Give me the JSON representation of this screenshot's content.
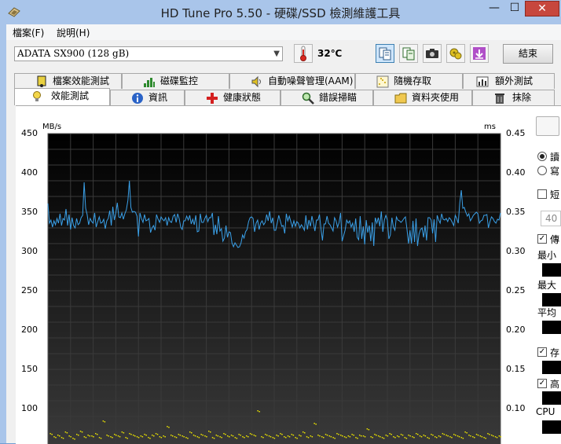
{
  "window": {
    "title": "HD Tune Pro 5.50 - 硬碟/SSD 檢測維護工具",
    "minimize_glyph": "—",
    "maximize_glyph": "☐",
    "close_glyph": "✕"
  },
  "menu": {
    "items": [
      "檔案(F)",
      "說明(H)"
    ]
  },
  "toolbar": {
    "drive": "ADATA SX900 (128 gB)",
    "temperature": "32℃",
    "exit_label": "結束",
    "buttons": [
      "copy-text-icon",
      "copy-info-icon",
      "screenshot-icon",
      "options-icon",
      "save-icon"
    ]
  },
  "tabs": {
    "row_back": [
      {
        "label": "檔案效能測試",
        "icon": "file-benchmark-icon"
      },
      {
        "label": "磁碟監控",
        "icon": "disk-monitor-icon"
      },
      {
        "label": "自動噪聲管理(AAM)",
        "icon": "speaker-icon"
      },
      {
        "label": "隨機存取",
        "icon": "random-access-icon"
      },
      {
        "label": "額外測試",
        "icon": "extra-tests-icon"
      }
    ],
    "row_front": [
      {
        "label": "效能測試",
        "icon": "benchmark-icon"
      },
      {
        "label": "資訊",
        "icon": "info-icon"
      },
      {
        "label": "健康狀態",
        "icon": "health-icon"
      },
      {
        "label": "錯誤掃瞄",
        "icon": "error-scan-icon"
      },
      {
        "label": "資料夾使用",
        "icon": "folder-icon"
      },
      {
        "label": "抹除",
        "icon": "erase-icon"
      }
    ],
    "selected": "效能測試"
  },
  "side_panel": {
    "radio1_label": "讀",
    "radio2_label": "寫",
    "checkbox1_label": "短",
    "spin_value": "40",
    "checkbox2_label": "傳",
    "min_label": "最小",
    "max_label": "最大",
    "avg_label": "平均",
    "checkbox3_label": "存",
    "checkbox4_label": "高",
    "cpu_label": "CPU"
  },
  "chart_data": {
    "type": "line",
    "title": "",
    "ylabel_left": "MB/s",
    "ylabel_right": "ms",
    "ylim_left": [
      50,
      450
    ],
    "ylim_right": [
      0.05,
      0.45
    ],
    "yticks_left": [
      "450",
      "400",
      "350",
      "300",
      "250",
      "200",
      "150",
      "100"
    ],
    "yticks_right": [
      "0.45",
      "0.40",
      "0.35",
      "0.30",
      "0.25",
      "0.20",
      "0.15",
      "0.10"
    ],
    "x_range": [
      0,
      100
    ],
    "grid": true,
    "colors": {
      "background": "#000000",
      "transfer_line": "#3aa0e8",
      "access_points": "#e8e000",
      "grid": "#3a3a3a"
    },
    "series": [
      {
        "values": [
          361,
          336,
          340,
          331,
          339,
          334,
          342,
          336,
          348,
          333,
          342,
          340,
          354,
          333,
          347,
          328,
          343,
          333,
          330,
          342,
          334,
          336,
          343,
          346,
          388,
          355,
          347,
          334,
          342,
          338,
          336,
          349,
          331,
          338,
          344,
          336,
          337,
          341,
          329,
          339,
          342,
          352,
          333,
          357,
          340,
          349,
          362,
          344,
          343,
          349,
          341,
          348,
          353,
          365,
          390,
          356,
          350,
          351,
          350,
          345,
          319,
          349,
          342,
          337,
          347,
          339,
          340,
          342,
          324,
          330,
          333,
          327,
          347,
          341,
          337,
          344,
          341,
          339,
          343,
          333,
          343,
          338,
          337,
          345,
          347,
          337,
          348,
          342,
          331,
          328,
          339,
          339,
          345,
          340,
          346,
          335,
          341,
          334,
          346,
          325,
          326,
          348,
          337,
          337,
          342,
          346,
          338,
          343,
          343,
          349,
          321,
          334,
          322,
          345,
          326,
          329,
          313,
          317,
          333,
          318,
          325,
          324,
          311,
          306,
          311,
          308,
          305,
          306,
          311,
          321,
          317,
          325,
          328,
          338,
          343,
          344,
          342,
          325,
          336,
          340,
          328,
          336,
          339,
          334,
          337,
          347,
          339,
          351,
          336,
          343,
          327,
          327,
          336,
          346,
          339,
          332,
          333,
          323,
          348,
          339,
          345,
          338,
          331,
          339,
          332,
          338,
          336,
          330,
          334,
          331,
          327,
          346,
          328,
          340,
          332,
          345,
          336,
          326,
          340,
          340,
          347,
          329,
          314,
          335,
          335,
          345,
          336,
          334,
          330,
          326,
          343,
          339,
          331,
          337,
          349,
          313,
          320,
          327,
          340,
          336,
          339,
          331,
          336,
          325,
          342,
          318,
          315,
          345,
          316,
          332,
          309,
          340,
          324,
          333,
          313,
          337,
          307,
          343,
          336,
          343,
          332,
          351,
          325,
          340,
          346,
          340,
          316,
          321,
          343,
          331,
          327,
          344,
          340,
          339,
          337,
          339,
          342,
          344,
          328,
          310,
          327,
          310,
          339,
          312,
          342,
          307,
          322,
          328,
          330,
          318,
          333,
          314,
          343,
          343,
          340,
          323,
          341,
          312,
          346,
          340,
          336,
          348,
          341,
          340,
          342,
          338,
          343,
          341,
          337,
          333,
          346,
          342,
          336,
          362,
          378,
          355,
          356,
          350,
          345,
          348,
          339,
          342,
          346,
          348,
          350,
          348,
          336,
          339,
          340,
          346,
          346,
          347,
          330,
          338,
          344,
          342,
          338,
          336,
          341,
          340,
          349
        ]
      }
    ],
    "access_time_points": [
      0.069,
      0.065,
      0.067,
      0.064,
      0.071,
      0.066,
      0.063,
      0.068,
      0.072,
      0.065,
      0.067,
      0.066,
      0.069,
      0.064,
      0.085,
      0.067,
      0.065,
      0.068,
      0.066,
      0.071,
      0.064,
      0.069,
      0.067,
      0.065,
      0.066,
      0.068,
      0.064,
      0.067,
      0.069,
      0.065,
      0.066,
      0.078,
      0.067,
      0.065,
      0.068,
      0.066,
      0.064,
      0.071,
      0.067,
      0.065,
      0.068,
      0.066,
      0.072,
      0.064,
      0.067,
      0.065,
      0.069,
      0.066,
      0.067,
      0.064,
      0.068,
      0.065,
      0.066,
      0.069,
      0.067,
      0.098,
      0.065,
      0.068,
      0.066,
      0.064,
      0.067,
      0.069,
      0.065,
      0.066,
      0.068,
      0.064,
      0.067,
      0.071,
      0.065,
      0.066,
      0.082,
      0.067,
      0.065,
      0.068,
      0.066,
      0.064,
      0.069,
      0.067,
      0.065,
      0.066,
      0.068,
      0.064,
      0.067,
      0.066,
      0.075,
      0.065,
      0.068,
      0.066,
      0.064,
      0.067,
      0.069,
      0.065,
      0.066,
      0.068,
      0.064,
      0.067,
      0.065,
      0.069,
      0.066,
      0.067,
      0.064,
      0.068,
      0.065,
      0.066,
      0.069,
      0.067,
      0.065,
      0.068,
      0.066,
      0.064,
      0.071,
      0.067,
      0.065,
      0.068,
      0.066,
      0.064,
      0.069,
      0.067,
      0.065,
      0.066
    ]
  }
}
